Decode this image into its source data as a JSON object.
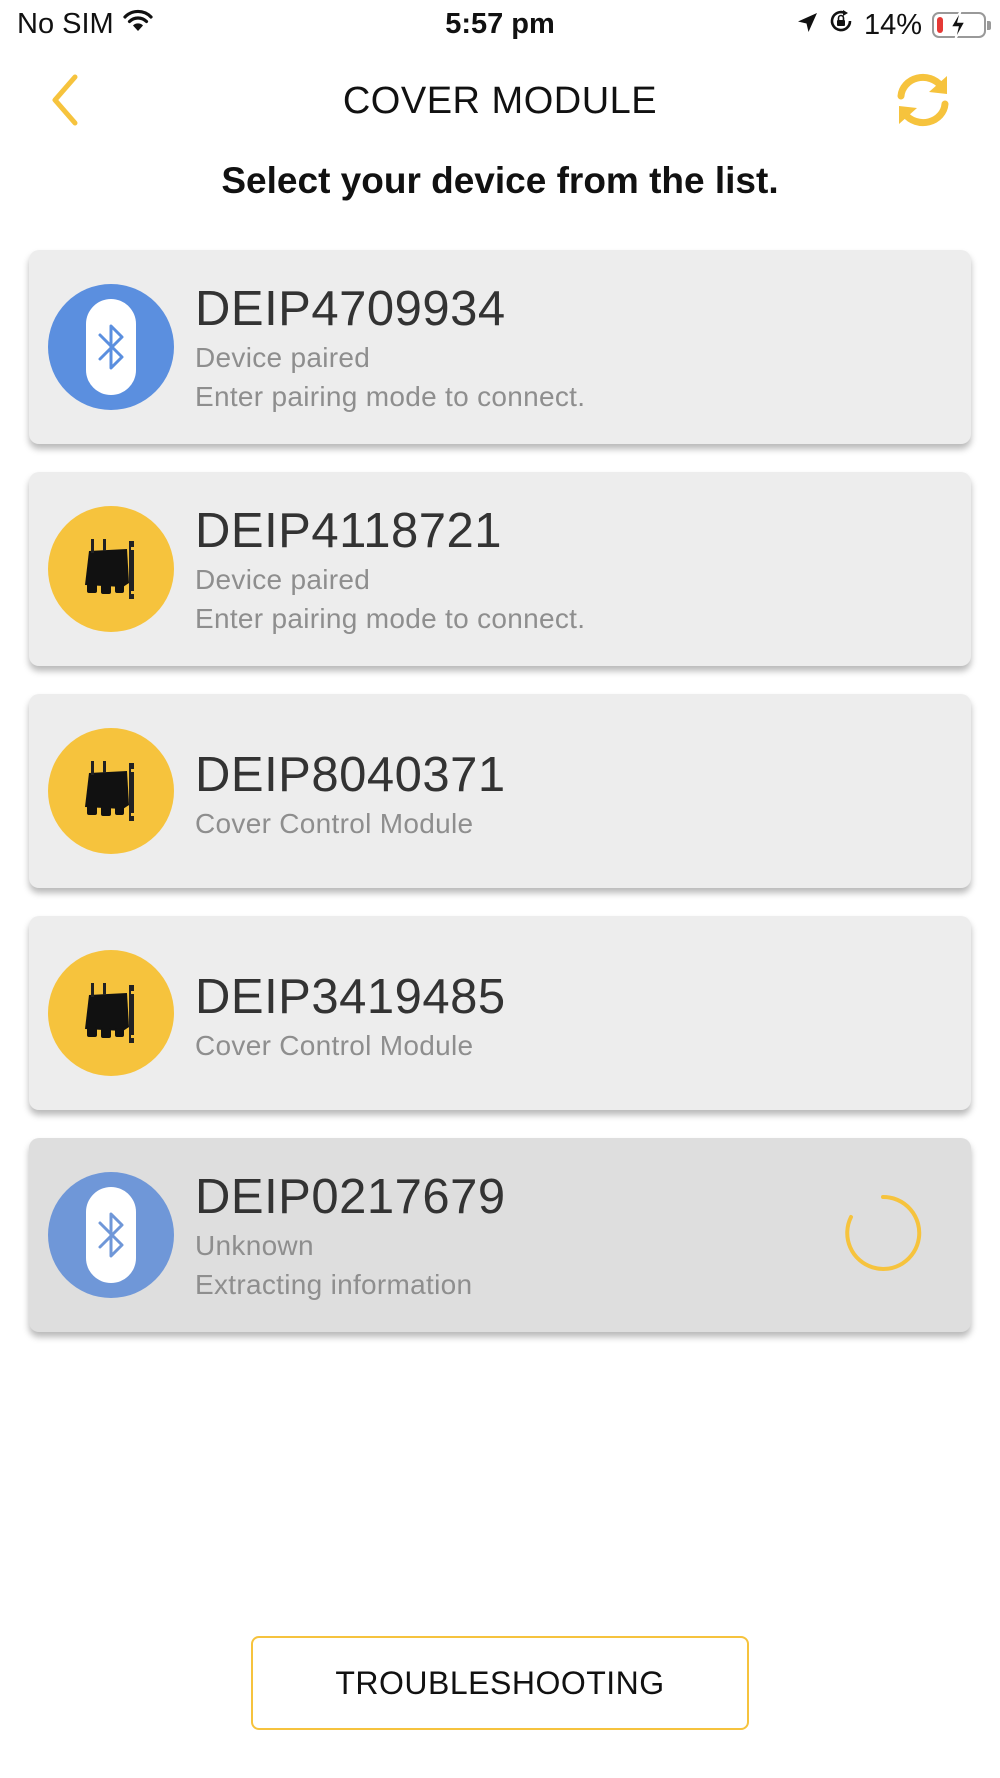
{
  "status_bar": {
    "carrier": "No SIM",
    "time": "5:57 pm",
    "battery_percent": "14%",
    "battery_level": 0.14,
    "icons": [
      "wifi-icon",
      "location-arrow-icon",
      "orientation-lock-icon",
      "battery-charging-icon"
    ]
  },
  "header": {
    "title": "COVER MODULE",
    "back_icon": "chevron-left-icon",
    "refresh_icon": "refresh-icon"
  },
  "subtitle": "Select your device from the list.",
  "devices": [
    {
      "name": "DEIP4709934",
      "line1": "Device paired",
      "line2": "Enter pairing mode to connect.",
      "icon": "bluetooth-icon"
    },
    {
      "name": "DEIP4118721",
      "line1": "Device paired",
      "line2": "Enter pairing mode to connect.",
      "icon": "cover-module-icon"
    },
    {
      "name": "DEIP8040371",
      "line1": "Cover Control Module",
      "icon": "cover-module-icon"
    },
    {
      "name": "DEIP3419485",
      "line1": "Cover Control Module",
      "icon": "cover-module-icon"
    },
    {
      "name": "DEIP0217679",
      "line1": "Unknown",
      "line2": "Extracting information",
      "icon": "bluetooth-icon",
      "loading": true
    }
  ],
  "troubleshooting_label": "TROUBLESHOOTING",
  "colors": {
    "accent": "#f6c33d",
    "bluetooth_blue": "#5b8fdf",
    "card_bg": "#ededed",
    "secondary_text": "#8e8e8e"
  }
}
